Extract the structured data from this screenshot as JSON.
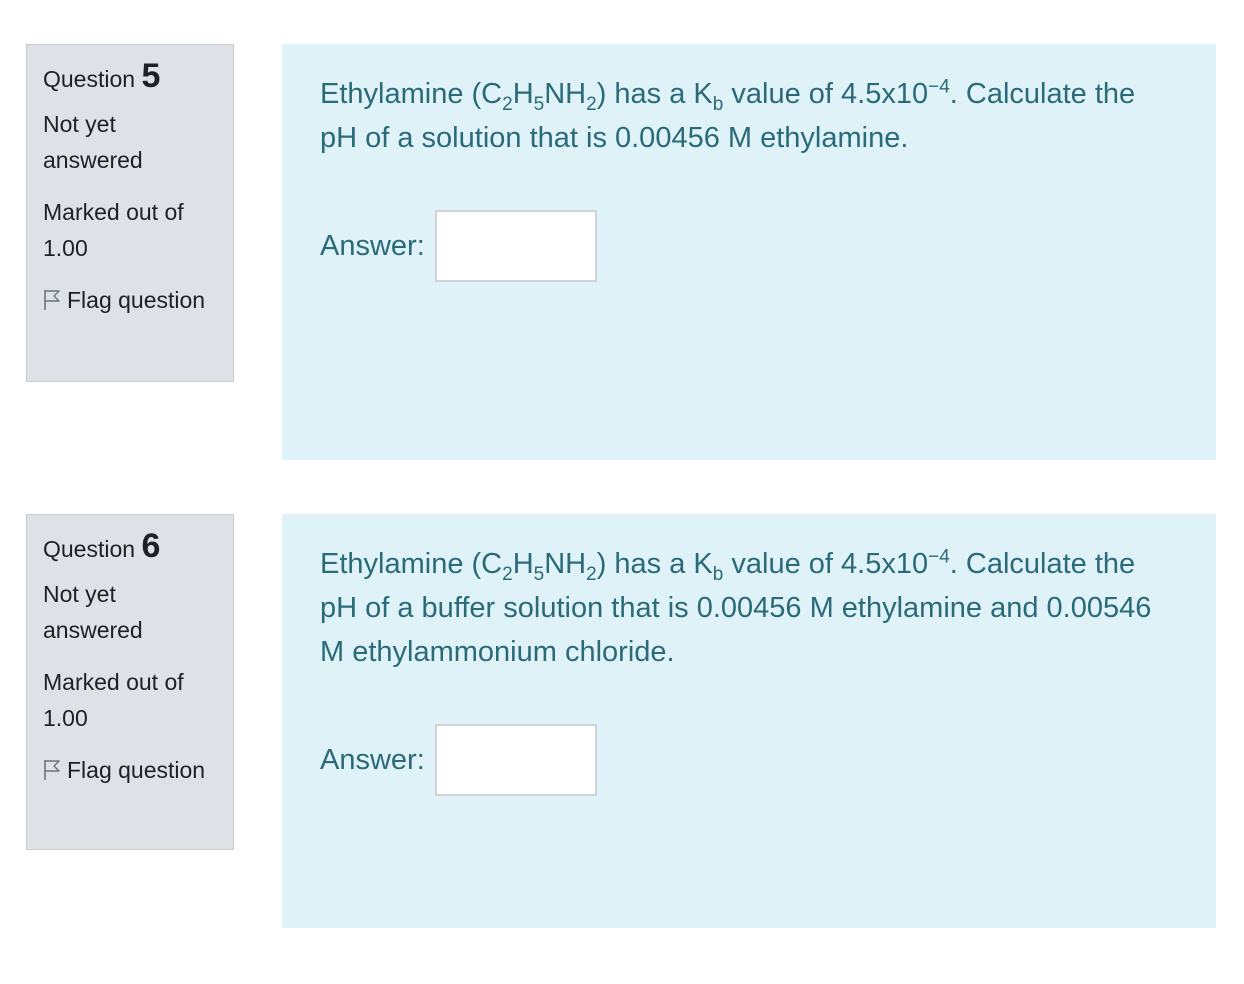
{
  "questions": [
    {
      "label": "Question",
      "number": "5",
      "state": "Not yet answered",
      "grade": "Marked out of 1.00",
      "flag_label": "Flag question",
      "flag_icon": "flag-outline-icon",
      "text": {
        "p1": "Ethylamine (C",
        "sub1": "2",
        "p2": "H",
        "sub2": "5",
        "p3": "NH",
        "sub3": "2",
        "p4": ") has a K",
        "sub4": "b",
        "p5": " value of 4.5x10",
        "sup1": "−4",
        "p6": ".  Calculate the pH of a solution that is 0.00456 M ethylamine."
      },
      "answer_label": "Answer:",
      "answer_value": ""
    },
    {
      "label": "Question",
      "number": "6",
      "state": "Not yet answered",
      "grade": "Marked out of 1.00",
      "flag_label": "Flag question",
      "flag_icon": "flag-outline-icon",
      "text": {
        "p1": "Ethylamine (C",
        "sub1": "2",
        "p2": "H",
        "sub2": "5",
        "p3": "NH",
        "sub3": "2",
        "p4": ") has a K",
        "sub4": "b",
        "p5": " value of 4.5x10",
        "sup1": "−4",
        "p6": ".  Calculate the pH of a  buffer solution that is 0.00456 M ethylamine and 0.00546 M ethylammonium chloride."
      },
      "answer_label": "Answer:",
      "answer_value": ""
    }
  ],
  "colors": {
    "info_bg": "#dee2e6",
    "content_bg": "#def2f8",
    "content_text": "#2b6a78"
  }
}
